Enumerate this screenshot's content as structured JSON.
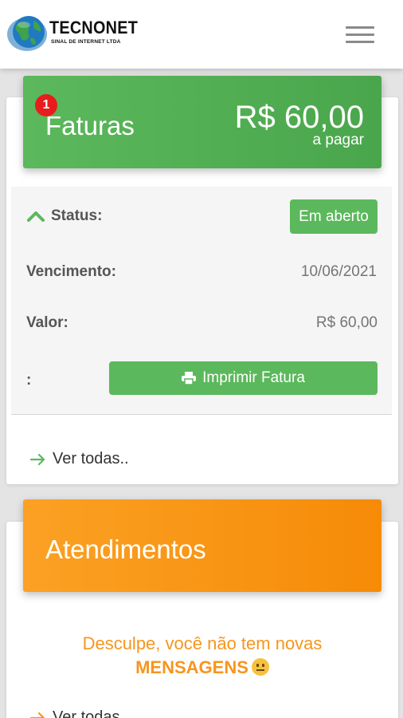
{
  "header": {
    "brand_name": "TECNONET",
    "brand_tagline": "SINAL DE INTERNET LTDA"
  },
  "faturas": {
    "title": "Faturas",
    "badge_count": "1",
    "amount": "R$ 60,00",
    "amount_caption": "a pagar",
    "status_label": "Status:",
    "status_value": "Em aberto",
    "due_label": "Vencimento:",
    "due_value": "10/06/2021",
    "value_label": "Valor:",
    "value_value": "R$ 60,00",
    "extra_label": ":",
    "print_button": "Imprimir Fatura",
    "see_all": "Ver todas.."
  },
  "atendimentos": {
    "title": "Atendimentos",
    "message_line1": "Desculpe, você não tem novas",
    "message_line2": "MENSAGENS",
    "see_all": "Ver todas.."
  },
  "colors": {
    "green": "#5cb85c",
    "orange": "#f7951d",
    "badge_red": "#e81c1c"
  }
}
